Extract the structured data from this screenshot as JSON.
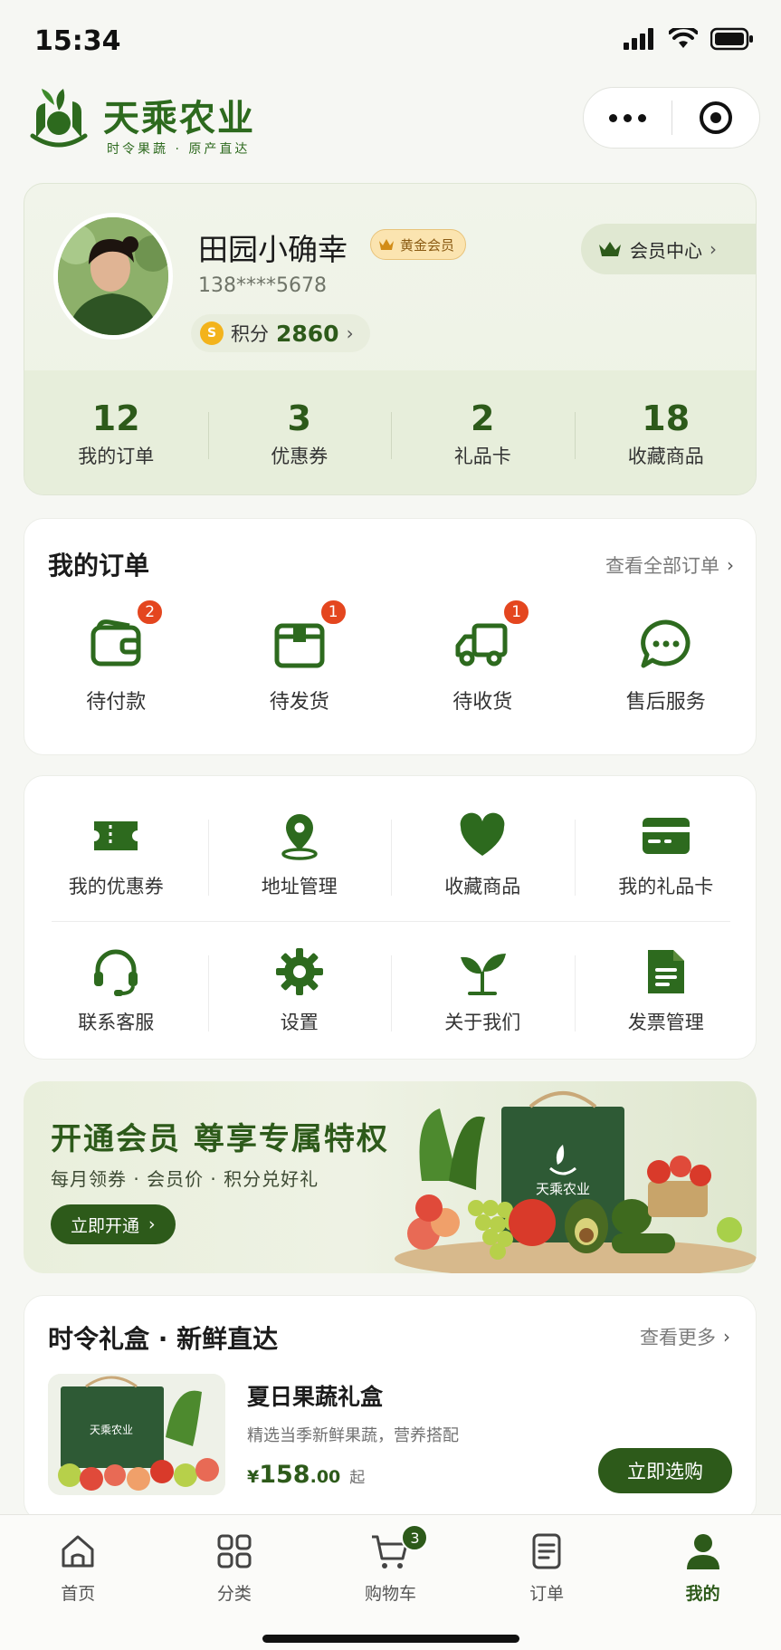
{
  "status_bar": {
    "time": "15:34"
  },
  "header": {
    "brand_name": "天乘农业",
    "slogan": "时令果蔬 · 原产直达"
  },
  "profile": {
    "name": "田园小确幸",
    "level_badge": "黄金会员",
    "phone": "138****5678",
    "points_label": "积分",
    "points_value": "2860",
    "coin_symbol": "S",
    "member_center_label": "会员中心",
    "stats": [
      {
        "value": "12",
        "label": "我的订单"
      },
      {
        "value": "3",
        "label": "优惠券"
      },
      {
        "value": "2",
        "label": "礼品卡"
      },
      {
        "value": "18",
        "label": "收藏商品"
      }
    ]
  },
  "orders": {
    "title": "我的订单",
    "view_all": "查看全部订单",
    "items": [
      {
        "label": "待付款",
        "badge": "2",
        "icon": "wallet-icon"
      },
      {
        "label": "待发货",
        "badge": "1",
        "icon": "package-icon"
      },
      {
        "label": "待收货",
        "badge": "1",
        "icon": "truck-icon"
      },
      {
        "label": "售后服务",
        "badge": "",
        "icon": "chat-icon"
      }
    ]
  },
  "services": {
    "items": [
      {
        "label": "我的优惠券",
        "icon": "coupon-icon"
      },
      {
        "label": "地址管理",
        "icon": "location-icon"
      },
      {
        "label": "收藏商品",
        "icon": "heart-icon"
      },
      {
        "label": "我的礼品卡",
        "icon": "gift-card-icon"
      },
      {
        "label": "联系客服",
        "icon": "headset-icon"
      },
      {
        "label": "设置",
        "icon": "gear-icon"
      },
      {
        "label": "关于我们",
        "icon": "sprout-icon"
      },
      {
        "label": "发票管理",
        "icon": "invoice-icon"
      }
    ]
  },
  "banner": {
    "title": "开通会员  尊享专属特权",
    "subtitle": "每月领券 · 会员价 · 积分兑好礼",
    "button_label": "立即开通",
    "box_text": "天乘农业"
  },
  "gift_section": {
    "title": "时令礼盒 · 新鲜直达",
    "more_label": "查看更多",
    "product": {
      "name": "夏日果蔬礼盒",
      "description": "精选当季新鲜果蔬，营养搭配",
      "currency": "¥",
      "price_int": "158",
      "price_dec": ".00",
      "price_suffix": "起",
      "buy_label": "立即选购",
      "box_text": "天乘农业"
    }
  },
  "tab_bar": {
    "tabs": [
      {
        "label": "首页",
        "icon": "home-icon",
        "active": false
      },
      {
        "label": "分类",
        "icon": "grid-icon",
        "active": false
      },
      {
        "label": "购物车",
        "icon": "cart-icon",
        "active": false,
        "badge": "3"
      },
      {
        "label": "订单",
        "icon": "order-doc-icon",
        "active": false
      },
      {
        "label": "我的",
        "icon": "user-icon",
        "active": true
      }
    ]
  },
  "colors": {
    "brand_green": "#2d5a1a",
    "badge_red": "#e4461f",
    "gold": "#f3b31c"
  }
}
